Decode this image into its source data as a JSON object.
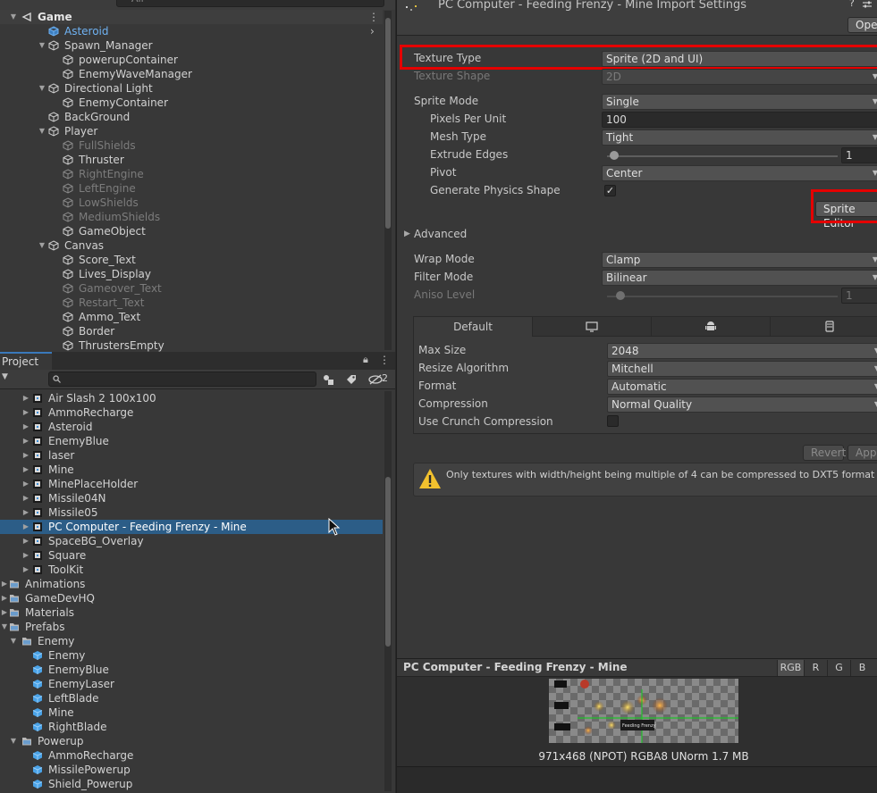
{
  "hierarchy": {
    "search_placeholder": "All",
    "scene_name": "Game",
    "items": [
      {
        "label": "Asteroid",
        "depth": 1,
        "arrow": "",
        "style": "blue"
      },
      {
        "label": "Spawn_Manager",
        "depth": 1,
        "arrow": "down",
        "style": ""
      },
      {
        "label": "powerupContainer",
        "depth": 2,
        "arrow": "",
        "style": ""
      },
      {
        "label": "EnemyWaveManager",
        "depth": 2,
        "arrow": "",
        "style": ""
      },
      {
        "label": "Directional Light",
        "depth": 1,
        "arrow": "down",
        "style": ""
      },
      {
        "label": "EnemyContainer",
        "depth": 2,
        "arrow": "",
        "style": ""
      },
      {
        "label": "BackGround",
        "depth": 1,
        "arrow": "",
        "style": ""
      },
      {
        "label": "Player",
        "depth": 1,
        "arrow": "down",
        "style": ""
      },
      {
        "label": "FullShields",
        "depth": 2,
        "arrow": "",
        "style": "dim"
      },
      {
        "label": "Thruster",
        "depth": 2,
        "arrow": "",
        "style": ""
      },
      {
        "label": "RightEngine",
        "depth": 2,
        "arrow": "",
        "style": "dim"
      },
      {
        "label": "LeftEngine",
        "depth": 2,
        "arrow": "",
        "style": "dim"
      },
      {
        "label": "LowShields",
        "depth": 2,
        "arrow": "",
        "style": "dim"
      },
      {
        "label": "MediumShields",
        "depth": 2,
        "arrow": "",
        "style": "dim"
      },
      {
        "label": "GameObject",
        "depth": 2,
        "arrow": "",
        "style": ""
      },
      {
        "label": "Canvas",
        "depth": 1,
        "arrow": "down",
        "style": ""
      },
      {
        "label": "Score_Text",
        "depth": 2,
        "arrow": "",
        "style": ""
      },
      {
        "label": "Lives_Display",
        "depth": 2,
        "arrow": "",
        "style": ""
      },
      {
        "label": "Gameover_Text",
        "depth": 2,
        "arrow": "",
        "style": "dim"
      },
      {
        "label": "Restart_Text",
        "depth": 2,
        "arrow": "",
        "style": "dim"
      },
      {
        "label": "Ammo_Text",
        "depth": 2,
        "arrow": "",
        "style": ""
      },
      {
        "label": "Border",
        "depth": 2,
        "arrow": "",
        "style": ""
      },
      {
        "label": "ThrustersEmpty",
        "depth": 2,
        "arrow": "",
        "style": ""
      }
    ]
  },
  "project": {
    "tab_label": "Project",
    "hidden_count": "2",
    "items": [
      {
        "label": "Air Slash 2 100x100",
        "depth": 2,
        "arrow": "right",
        "icon": "sprite",
        "selected": false
      },
      {
        "label": "AmmoRecharge",
        "depth": 2,
        "arrow": "right",
        "icon": "sprite",
        "selected": false
      },
      {
        "label": "Asteroid",
        "depth": 2,
        "arrow": "right",
        "icon": "sprite",
        "selected": false
      },
      {
        "label": "EnemyBlue",
        "depth": 2,
        "arrow": "right",
        "icon": "sprite",
        "selected": false
      },
      {
        "label": "laser",
        "depth": 2,
        "arrow": "right",
        "icon": "sprite",
        "selected": false
      },
      {
        "label": "Mine",
        "depth": 2,
        "arrow": "right",
        "icon": "sprite",
        "selected": false
      },
      {
        "label": "MinePlaceHolder",
        "depth": 2,
        "arrow": "right",
        "icon": "sprite",
        "selected": false
      },
      {
        "label": "Missile04N",
        "depth": 2,
        "arrow": "right",
        "icon": "sprite",
        "selected": false
      },
      {
        "label": "Missile05",
        "depth": 2,
        "arrow": "right",
        "icon": "sprite",
        "selected": false
      },
      {
        "label": "PC Computer - Feeding Frenzy - Mine",
        "depth": 2,
        "arrow": "right",
        "icon": "sprite",
        "selected": true
      },
      {
        "label": "SpaceBG_Overlay",
        "depth": 2,
        "arrow": "right",
        "icon": "sprite",
        "selected": false
      },
      {
        "label": "Square",
        "depth": 2,
        "arrow": "right",
        "icon": "sprite",
        "selected": false
      },
      {
        "label": "ToolKit",
        "depth": 2,
        "arrow": "right",
        "icon": "sprite",
        "selected": false
      },
      {
        "label": "Animations",
        "depth": 0,
        "arrow": "right",
        "icon": "folder",
        "selected": false
      },
      {
        "label": "GameDevHQ",
        "depth": 0,
        "arrow": "right",
        "icon": "folder",
        "selected": false
      },
      {
        "label": "Materials",
        "depth": 0,
        "arrow": "right",
        "icon": "folder",
        "selected": false
      },
      {
        "label": "Prefabs",
        "depth": 0,
        "arrow": "down",
        "icon": "folder",
        "selected": false
      },
      {
        "label": "Enemy",
        "depth": 1,
        "arrow": "down",
        "icon": "folder",
        "selected": false
      },
      {
        "label": "Enemy",
        "depth": 2,
        "arrow": "",
        "icon": "prefab",
        "selected": false
      },
      {
        "label": "EnemyBlue",
        "depth": 2,
        "arrow": "",
        "icon": "prefab",
        "selected": false
      },
      {
        "label": "EnemyLaser",
        "depth": 2,
        "arrow": "",
        "icon": "prefab",
        "selected": false
      },
      {
        "label": "LeftBlade",
        "depth": 2,
        "arrow": "",
        "icon": "prefab",
        "selected": false
      },
      {
        "label": "Mine",
        "depth": 2,
        "arrow": "",
        "icon": "prefab",
        "selected": false
      },
      {
        "label": "RightBlade",
        "depth": 2,
        "arrow": "",
        "icon": "prefab",
        "selected": false
      },
      {
        "label": "Powerup",
        "depth": 1,
        "arrow": "down",
        "icon": "folder",
        "selected": false
      },
      {
        "label": "AmmoRecharge",
        "depth": 2,
        "arrow": "",
        "icon": "prefab",
        "selected": false
      },
      {
        "label": "MissilePowerup",
        "depth": 2,
        "arrow": "",
        "icon": "prefab",
        "selected": false
      },
      {
        "label": "Shield_Powerup",
        "depth": 2,
        "arrow": "",
        "icon": "prefab",
        "selected": false
      }
    ]
  },
  "inspector": {
    "title": "PC Computer - Feeding Frenzy - Mine Import Settings",
    "open_button": "Open",
    "texture_type": {
      "label": "Texture Type",
      "value": "Sprite (2D and UI)"
    },
    "texture_shape": {
      "label": "Texture Shape",
      "value": "2D"
    },
    "sprite_mode": {
      "label": "Sprite Mode",
      "value": "Single"
    },
    "pixels_per_unit": {
      "label": "Pixels Per Unit",
      "value": "100"
    },
    "mesh_type": {
      "label": "Mesh Type",
      "value": "Tight"
    },
    "extrude_edges": {
      "label": "Extrude Edges",
      "value": "1",
      "slider": 0.03
    },
    "pivot": {
      "label": "Pivot",
      "value": "Center"
    },
    "physics_shape": {
      "label": "Generate Physics Shape",
      "checked": "✓"
    },
    "sprite_editor_button": "Sprite Editor",
    "advanced": "Advanced",
    "wrap_mode": {
      "label": "Wrap Mode",
      "value": "Clamp"
    },
    "filter_mode": {
      "label": "Filter Mode",
      "value": "Bilinear"
    },
    "aniso_level": {
      "label": "Aniso Level",
      "value": "1",
      "slider": 0.06
    },
    "platform_tabs": [
      "Default",
      "",
      "",
      ""
    ],
    "max_size": {
      "label": "Max Size",
      "value": "2048"
    },
    "resize_algorithm": {
      "label": "Resize Algorithm",
      "value": "Mitchell"
    },
    "format": {
      "label": "Format",
      "value": "Automatic"
    },
    "compression": {
      "label": "Compression",
      "value": "Normal Quality"
    },
    "crunch": {
      "label": "Use Crunch Compression",
      "checked": ""
    },
    "revert_button": "Revert",
    "apply_button": "Apply",
    "warning": "Only textures with width/height being multiple of 4 can be compressed to DXT5 format",
    "highlight_color": "#e50000"
  },
  "preview": {
    "title": "PC Computer - Feeding Frenzy - Mine",
    "channels": [
      "RGB",
      "R",
      "G",
      "B"
    ],
    "info": "971x468 (NPOT)  RGBA8 UNorm   1.7 MB",
    "sprite_text": "Feeding Frenzy"
  }
}
